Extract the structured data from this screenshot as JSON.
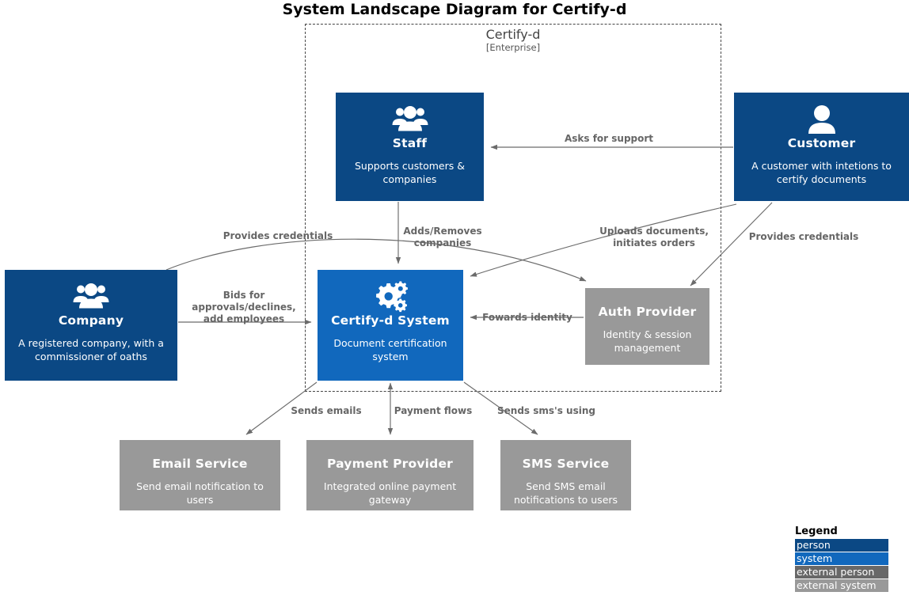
{
  "title": "System Landscape Diagram for Certify-d",
  "boundary": {
    "name": "Certify-d",
    "type": "[Enterprise]"
  },
  "nodes": [
    {
      "id": "staff",
      "name": "Staff",
      "description": "Supports customers & companies",
      "kind": "person",
      "icon": "people-group-icon",
      "color": "#0b4884"
    },
    {
      "id": "customer",
      "name": "Customer",
      "description": "A customer with intetions to certify documents",
      "kind": "person",
      "icon": "person-icon",
      "color": "#0b4884"
    },
    {
      "id": "company",
      "name": "Company",
      "description": "A registered company, with a commissioner of oaths",
      "kind": "person",
      "icon": "people-group-icon",
      "color": "#0b4884"
    },
    {
      "id": "certifyd",
      "name": "Certify-d System",
      "description": "Document certification system",
      "kind": "system",
      "icon": "gears-icon",
      "color": "#1168bd"
    },
    {
      "id": "auth",
      "name": "Auth Provider",
      "description": "Identity & session management",
      "kind": "external system",
      "icon": "none",
      "color": "#999999"
    },
    {
      "id": "email",
      "name": "Email Service",
      "description": "Send email notification to users",
      "kind": "external system",
      "icon": "none",
      "color": "#999999"
    },
    {
      "id": "payment",
      "name": "Payment Provider",
      "description": "Integrated online payment gateway",
      "kind": "external system",
      "icon": "none",
      "color": "#999999"
    },
    {
      "id": "sms",
      "name": "SMS Service",
      "description": "Send SMS email notifications to users",
      "kind": "external system",
      "icon": "none",
      "color": "#999999"
    }
  ],
  "relationships": [
    {
      "id": "rel-asks-support",
      "label": "Asks for support",
      "from": "customer",
      "to": "staff"
    },
    {
      "id": "rel-provides-credentials-company",
      "label": "Provides credentials",
      "from": "company",
      "to": "auth"
    },
    {
      "id": "rel-adds-removes",
      "label": "Adds/Removes\ncompanies",
      "from": "staff",
      "to": "certifyd"
    },
    {
      "id": "rel-bids",
      "label": "Bids for\napprovals/declines,\nadd employees",
      "from": "company",
      "to": "certifyd"
    },
    {
      "id": "rel-uploads",
      "label": "Uploads documents,\ninitiates orders",
      "from": "customer",
      "to": "certifyd"
    },
    {
      "id": "rel-provides-credentials-customer",
      "label": "Provides credentials",
      "from": "customer",
      "to": "auth"
    },
    {
      "id": "rel-fowards-identity",
      "label": "Fowards identity",
      "from": "auth",
      "to": "certifyd"
    },
    {
      "id": "rel-sends-emails",
      "label": "Sends emails",
      "from": "certifyd",
      "to": "email"
    },
    {
      "id": "rel-payment-flows",
      "label": "Payment flows",
      "from": "certifyd",
      "to": "payment"
    },
    {
      "id": "rel-sends-sms",
      "label": "Sends sms's using",
      "from": "certifyd",
      "to": "sms"
    }
  ],
  "legend": {
    "title": "Legend",
    "items": [
      {
        "label": "person",
        "color": "#0b4884"
      },
      {
        "label": "system",
        "color": "#1168bd"
      },
      {
        "label": "external person",
        "color": "#686868"
      },
      {
        "label": "external system",
        "color": "#999999"
      }
    ]
  }
}
